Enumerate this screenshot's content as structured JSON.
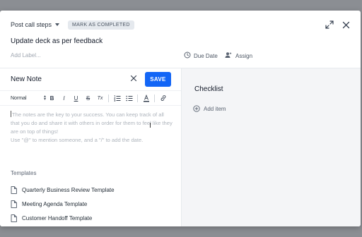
{
  "header": {
    "step_select": "Post call steps",
    "mark_completed": "MARK AS COMPLETED",
    "title": "Update deck as per feedback",
    "add_label_placeholder": "Add Label...",
    "due_date": "Due Date",
    "assign": "Assign"
  },
  "note": {
    "title": "New Note",
    "save_label": "SAVE",
    "toolbar": {
      "text_style": "Normal",
      "buttons": [
        "B",
        "I",
        "U",
        "S",
        "Tx"
      ]
    },
    "editor_placeholder": "The notes are the key to your success. You can keep track of all that you do and share it with others in order for them to feel like they are on top of things!",
    "editor_hint": "Use \"@\" to mention someone, and a \"/\" to add the date."
  },
  "templates": {
    "label": "Templates",
    "items": [
      "Quarterly Business Review Template",
      "Meeting Agenda Template",
      "Customer Handoff Template"
    ]
  },
  "checklist": {
    "title": "Checklist",
    "add_item": "Add item"
  },
  "colors": {
    "accent": "#1366f6",
    "backdrop": "#8b8e93",
    "pane_bg": "#f4f5f7"
  }
}
